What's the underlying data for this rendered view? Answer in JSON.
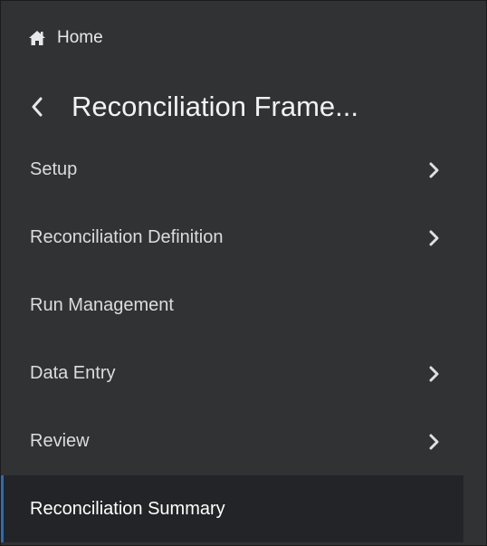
{
  "header": {
    "home_label": "Home",
    "home_icon": "home-icon",
    "title": "Reconciliation Frame...",
    "back_icon": "chevron-left-icon"
  },
  "menu": {
    "items": [
      {
        "label": "Setup",
        "has_submenu": true
      },
      {
        "label": "Reconciliation Definition",
        "has_submenu": true
      },
      {
        "label": "Run Management",
        "has_submenu": false
      },
      {
        "label": "Data Entry",
        "has_submenu": true
      },
      {
        "label": "Review",
        "has_submenu": true
      },
      {
        "label": "Reconciliation Summary",
        "has_submenu": false,
        "selected": true
      }
    ]
  },
  "colors": {
    "background": "#313234",
    "selected_background": "#232427",
    "selected_accent": "#2b6bb8",
    "text": "#dcdcdc"
  }
}
